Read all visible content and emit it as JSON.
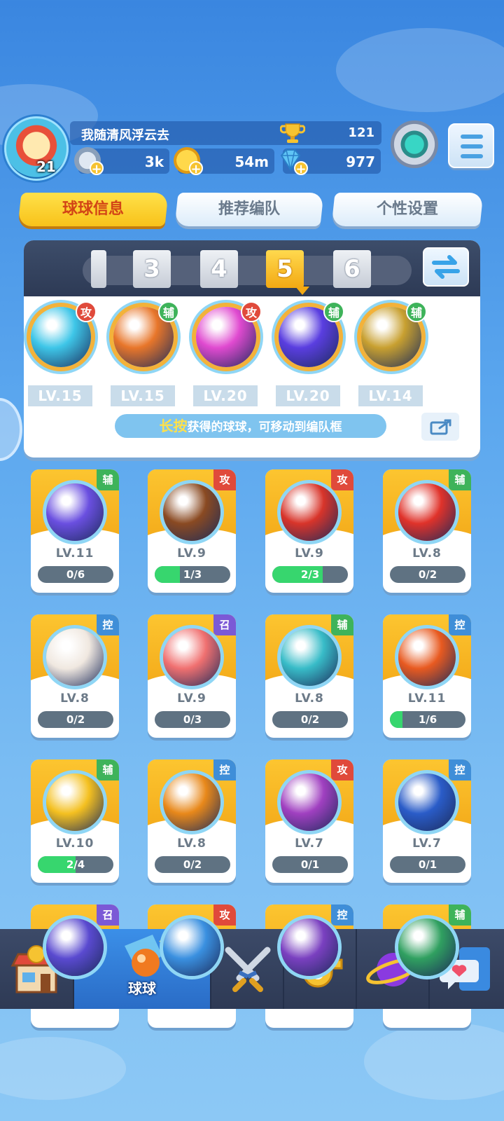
{
  "player": {
    "avatar_level": "21",
    "name": "我随清风浮云去",
    "trophies": "121",
    "energy": "3k",
    "coins": "54m",
    "gems": "977"
  },
  "tabs": [
    {
      "label": "球球信息",
      "active": true
    },
    {
      "label": "推荐编队",
      "active": false
    },
    {
      "label": "个性设置",
      "active": false
    }
  ],
  "team": {
    "slots": [
      "",
      "3",
      "4",
      "5",
      "6"
    ],
    "active_slot": "5",
    "balls": [
      {
        "role": "攻",
        "level": "LV.15",
        "color": "#3ec6e8",
        "icon": "sword-shield-icon"
      },
      {
        "role": "辅",
        "level": "LV.15",
        "color": "#e8762a",
        "icon": "wings-icon"
      },
      {
        "role": "攻",
        "level": "LV.20",
        "color": "#e04ad0",
        "icon": "cracked-shield-icon"
      },
      {
        "role": "辅",
        "level": "LV.20",
        "color": "#5a3ee0",
        "icon": "swap-arrows-icon"
      },
      {
        "role": "辅",
        "level": "LV.14",
        "color": "#c8a030",
        "icon": "crowd-icon"
      }
    ],
    "hint_highlight": "长按",
    "hint_text": "获得的球球，可移动到编队框"
  },
  "balls": [
    {
      "role": "辅",
      "role_type": "sup",
      "level": "LV.11",
      "progress": "0/6",
      "fraction": 0,
      "color": "#6a4fe0",
      "icon": "lightning-icon"
    },
    {
      "role": "攻",
      "role_type": "atk",
      "level": "LV.9",
      "progress": "1/3",
      "fraction": 0.33,
      "color": "#8a4a22",
      "icon": "infinity-icon"
    },
    {
      "role": "攻",
      "role_type": "atk",
      "level": "LV.9",
      "progress": "2/3",
      "fraction": 0.67,
      "color": "#d8342a",
      "icon": "opera-mask-icon"
    },
    {
      "role": "辅",
      "role_type": "sup",
      "level": "LV.8",
      "progress": "0/2",
      "fraction": 0,
      "color": "#e0322a",
      "icon": "red-envelope-icon"
    },
    {
      "role": "控",
      "role_type": "ctl",
      "level": "LV.8",
      "progress": "0/2",
      "fraction": 0,
      "color": "#f0e8e0",
      "icon": "aries-icon"
    },
    {
      "role": "召",
      "role_type": "smn",
      "level": "LV.9",
      "progress": "0/3",
      "fraction": 0,
      "color": "#f07070",
      "icon": "deity-icon"
    },
    {
      "role": "辅",
      "role_type": "sup",
      "level": "LV.8",
      "progress": "0/2",
      "fraction": 0,
      "color": "#38bcc8",
      "icon": "hero-icon"
    },
    {
      "role": "控",
      "role_type": "ctl",
      "level": "LV.11",
      "progress": "1/6",
      "fraction": 0.17,
      "color": "#e85a20",
      "icon": "star-burst-icon"
    },
    {
      "role": "辅",
      "role_type": "sup",
      "level": "LV.10",
      "progress": "2/4",
      "fraction": 0.5,
      "color": "#f4c020",
      "icon": "sun-icon"
    },
    {
      "role": "控",
      "role_type": "ctl",
      "level": "LV.8",
      "progress": "0/2",
      "fraction": 0,
      "color": "#e8881a",
      "icon": "crystal-icon"
    },
    {
      "role": "攻",
      "role_type": "atk",
      "level": "LV.7",
      "progress": "0/1",
      "fraction": 0,
      "color": "#a040c0",
      "icon": "emblem-icon"
    },
    {
      "role": "控",
      "role_type": "ctl",
      "level": "LV.7",
      "progress": "0/1",
      "fraction": 0,
      "color": "#2a5cc8",
      "icon": "ultraman-icon"
    },
    {
      "role": "召",
      "role_type": "smn",
      "level": "",
      "progress": "",
      "fraction": 0,
      "color": "#5a4ad0",
      "icon": "orb-icon"
    },
    {
      "role": "攻",
      "role_type": "atk",
      "level": "",
      "progress": "",
      "fraction": 0,
      "color": "#3a90e0",
      "icon": "orb-icon"
    },
    {
      "role": "控",
      "role_type": "ctl",
      "level": "",
      "progress": "",
      "fraction": 0,
      "color": "#7a40c0",
      "icon": "orb-icon"
    },
    {
      "role": "辅",
      "role_type": "sup",
      "level": "",
      "progress": "",
      "fraction": 0,
      "color": "#30a060",
      "icon": "orb-icon"
    }
  ],
  "nav": [
    {
      "label": "",
      "icon": "shop-icon"
    },
    {
      "label": "球球",
      "icon": "balls-icon",
      "active": true
    },
    {
      "label": "",
      "icon": "crossed-swords-icon"
    },
    {
      "label": "",
      "icon": "whistle-icon"
    },
    {
      "label": "",
      "icon": "planet-icon",
      "notification": true
    },
    {
      "label": "",
      "icon": "chat-heart-icon"
    }
  ]
}
